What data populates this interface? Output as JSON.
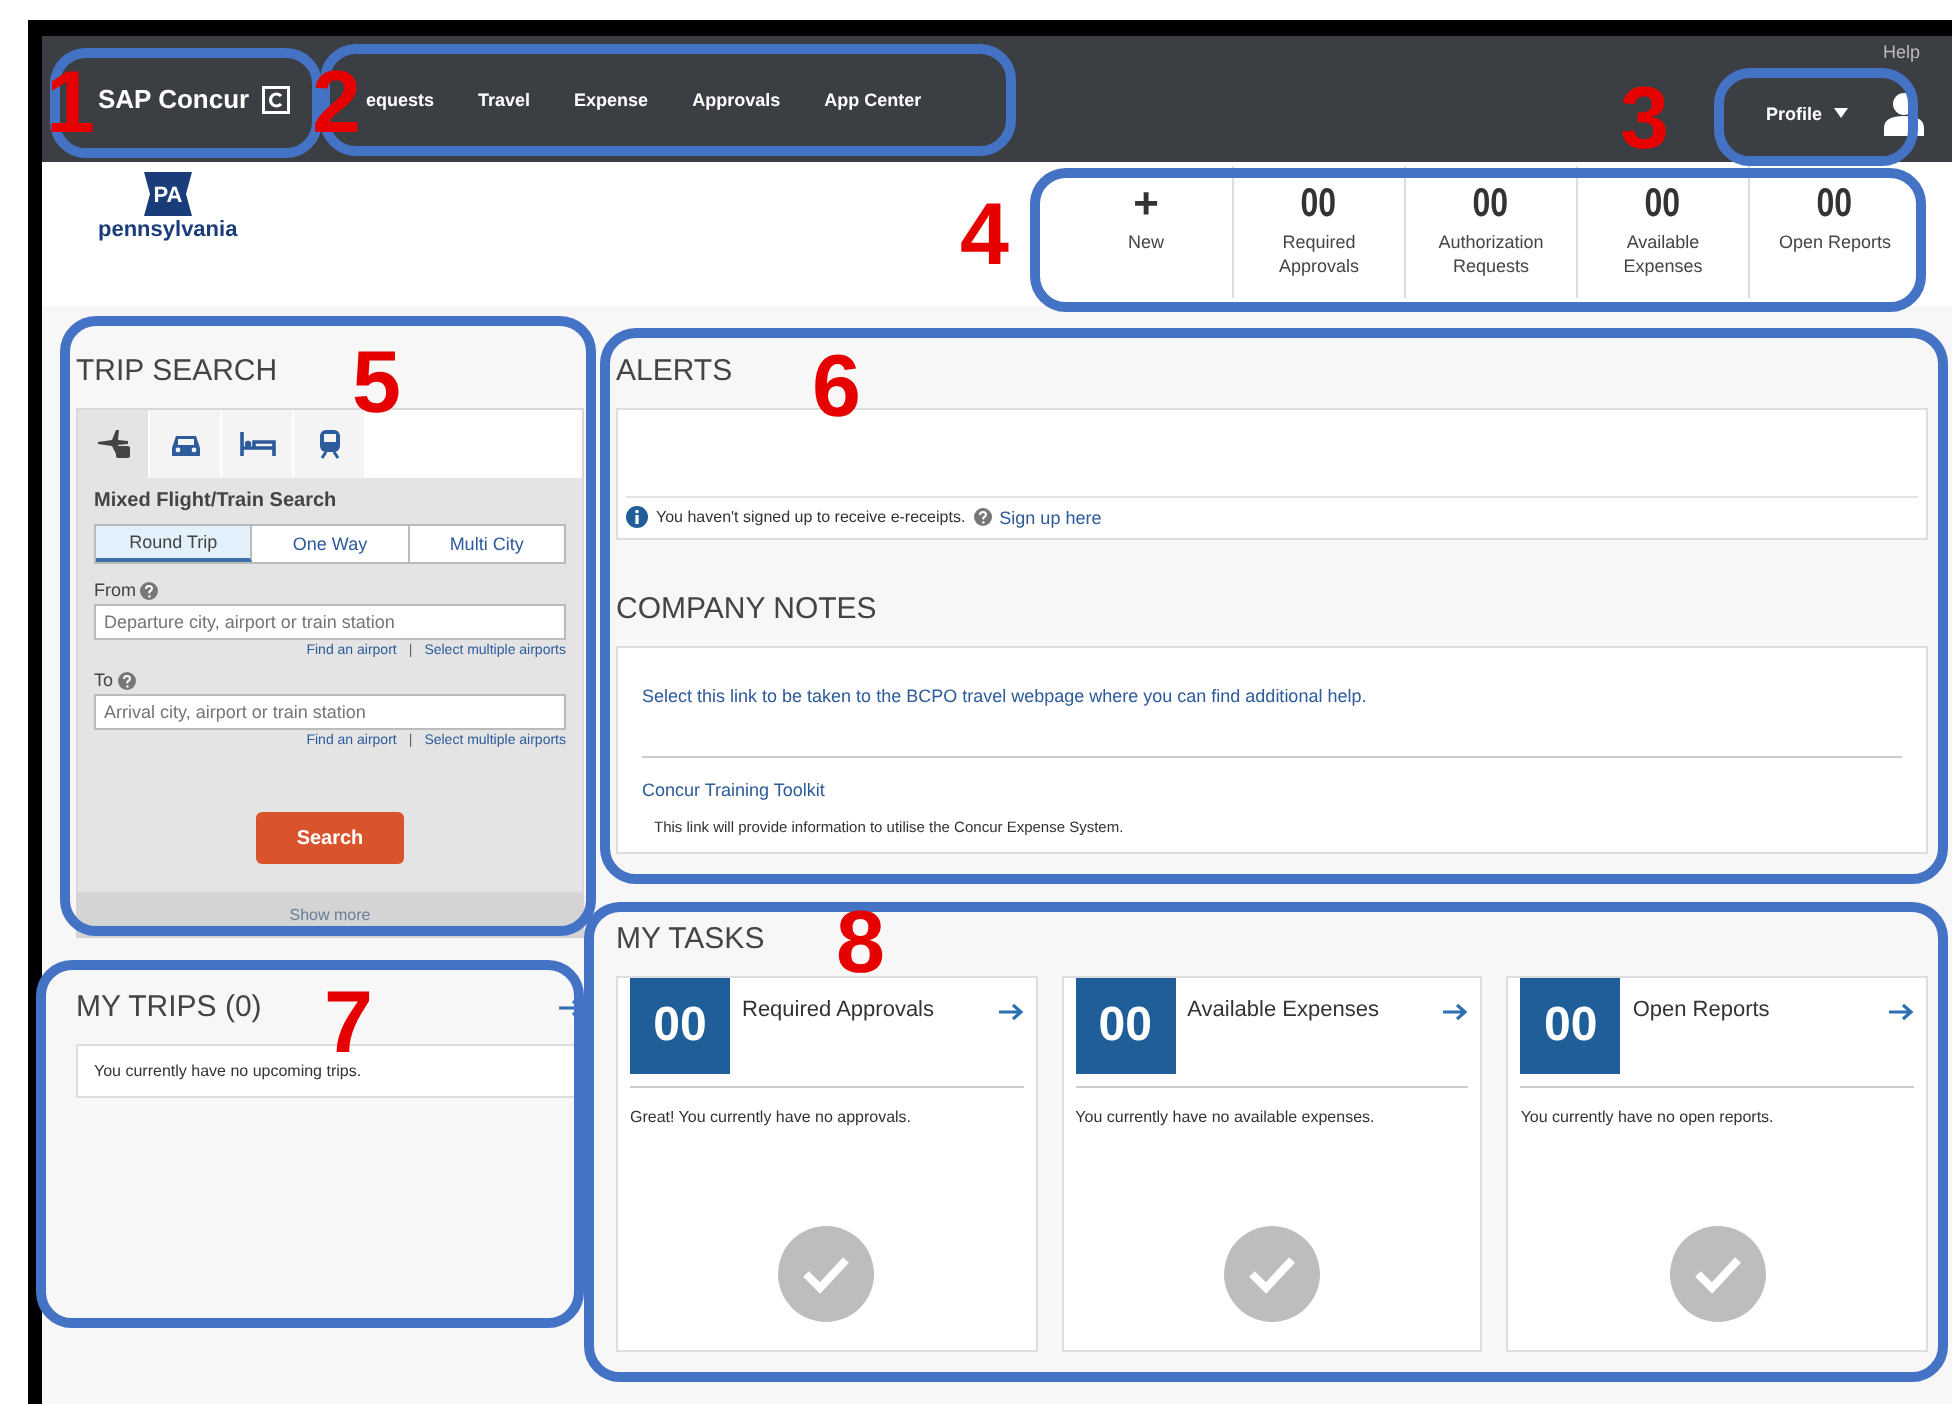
{
  "brand": {
    "name": "SAP Concur"
  },
  "nav": [
    {
      "label": "equests"
    },
    {
      "label": "Travel"
    },
    {
      "label": "Expense"
    },
    {
      "label": "Approvals"
    },
    {
      "label": "App Center"
    }
  ],
  "help": "Help",
  "profile": {
    "label": "Profile"
  },
  "org_logo": {
    "badge": "PA",
    "name": "pennsylvania"
  },
  "stats": [
    {
      "kind": "action",
      "value": "+",
      "label": "New"
    },
    {
      "kind": "count",
      "value": "00",
      "label": "Required Approvals"
    },
    {
      "kind": "count",
      "value": "00",
      "label": "Authorization Requests"
    },
    {
      "kind": "count",
      "value": "00",
      "label": "Available Expenses"
    },
    {
      "kind": "count",
      "value": "00",
      "label": "Open Reports"
    }
  ],
  "trip_search": {
    "title": "TRIP SEARCH",
    "modes": [
      {
        "kind": "flight",
        "selected": true
      },
      {
        "kind": "car",
        "selected": false
      },
      {
        "kind": "hotel",
        "selected": false
      },
      {
        "kind": "train",
        "selected": false
      }
    ],
    "subtitle": "Mixed Flight/Train Search",
    "trip_types": [
      {
        "label": "Round Trip",
        "selected": true
      },
      {
        "label": "One Way",
        "selected": false
      },
      {
        "label": "Multi City",
        "selected": false
      }
    ],
    "fields": [
      {
        "label": "From",
        "placeholder": "Departure city, airport or train station",
        "links": [
          "Find an airport",
          "Select multiple airports"
        ],
        "separator": "|"
      },
      {
        "label": "To",
        "placeholder": "Arrival city, airport or train station",
        "links": [
          "Find an airport",
          "Select multiple airports"
        ],
        "separator": "|"
      }
    ],
    "search_button": "Search",
    "show_more": "Show more"
  },
  "alerts": {
    "title": "ALERTS",
    "message": "You haven't signed up to receive e-receipts.",
    "link": "Sign up here"
  },
  "company_notes": {
    "title": "COMPANY NOTES",
    "items": [
      {
        "link": "Select this link to be taken to the BCPO travel webpage where you can find additional help."
      },
      {
        "link": "Concur Training Toolkit",
        "description": "This link will provide information to utilise the Concur Expense System."
      }
    ]
  },
  "my_trips": {
    "title": "MY TRIPS (0)",
    "message": "You currently have no upcoming trips."
  },
  "my_tasks": {
    "title": "MY TASKS",
    "cards": [
      {
        "count": "00",
        "title": "Required Approvals",
        "message": "Great! You currently have no approvals."
      },
      {
        "count": "00",
        "title": "Available Expenses",
        "message": "You currently have no available expenses."
      },
      {
        "count": "00",
        "title": "Open Reports",
        "message": "You currently have no open reports."
      }
    ]
  },
  "annotations": [
    {
      "number": "1"
    },
    {
      "number": "2"
    },
    {
      "number": "3"
    },
    {
      "number": "4"
    },
    {
      "number": "5"
    },
    {
      "number": "6"
    },
    {
      "number": "7"
    },
    {
      "number": "8"
    }
  ]
}
